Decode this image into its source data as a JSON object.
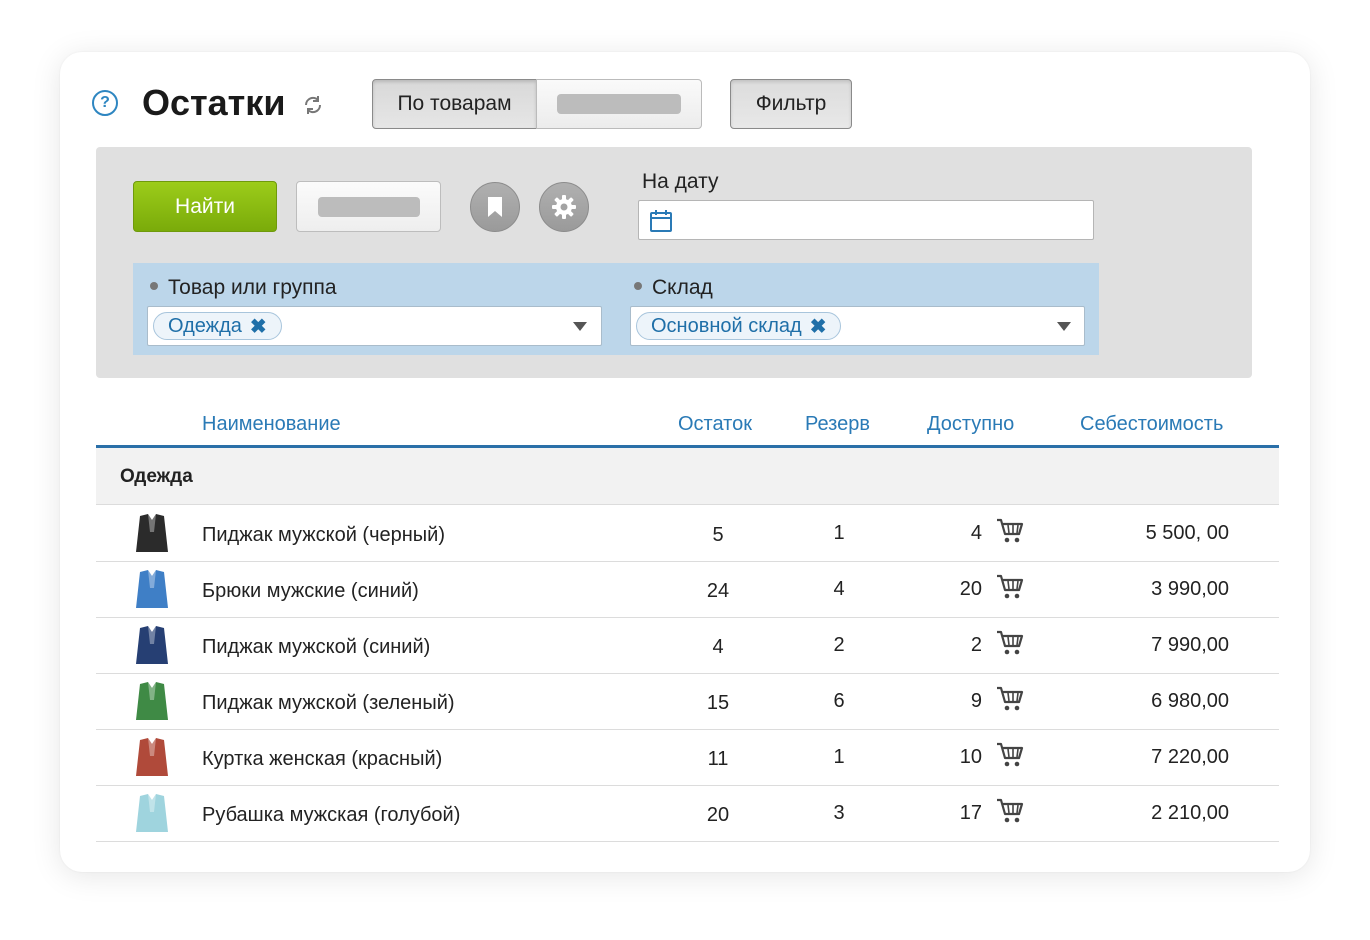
{
  "header": {
    "title": "Остатки",
    "tab_by_goods": "По товарам",
    "filter_button": "Фильтр"
  },
  "filter_panel": {
    "find_button": "Найти",
    "date_label": "На дату",
    "date_value": "",
    "goods_label": "Товар или группа",
    "goods_tag": "Одежда",
    "warehouse_label": "Склад",
    "warehouse_tag": "Основной склад"
  },
  "table": {
    "columns": [
      "Наименование",
      "Остаток",
      "Резерв",
      "Доступно",
      "Себестоимость"
    ],
    "group_name": "Одежда",
    "rows": [
      {
        "name": "Пиджак мужской (черный)",
        "stock": "5",
        "reserve": "1",
        "available": "4",
        "cost": "5 500, 00",
        "color": "#2b2b2b"
      },
      {
        "name": "Брюки мужские (синий)",
        "stock": "24",
        "reserve": "4",
        "available": "20",
        "cost": "3 990,00",
        "color": "#3f7fc6"
      },
      {
        "name": "Пиджак мужской (синий)",
        "stock": "4",
        "reserve": "2",
        "available": "2",
        "cost": "7 990,00",
        "color": "#263f73"
      },
      {
        "name": "Пиджак мужской (зеленый)",
        "stock": "15",
        "reserve": "6",
        "available": "9",
        "cost": "6 980,00",
        "color": "#3f8a45"
      },
      {
        "name": "Куртка женская (красный)",
        "stock": "11",
        "reserve": "1",
        "available": "10",
        "cost": "7 220,00",
        "color": "#b04a3a"
      },
      {
        "name": "Рубашка мужская (голубой)",
        "stock": "20",
        "reserve": "3",
        "available": "17",
        "cost": "2 210,00",
        "color": "#9fd4de"
      }
    ]
  },
  "icons": {
    "help": "question-icon",
    "refresh": "refresh-icon",
    "bookmark": "bookmark-icon",
    "settings": "gear-icon",
    "calendar": "calendar-icon",
    "cart": "cart-icon"
  },
  "colors": {
    "accent": "#2a7ab6",
    "find_button": "#8cbd12",
    "panel": "#e0e0e0",
    "filter_area": "#bcd6ea"
  }
}
